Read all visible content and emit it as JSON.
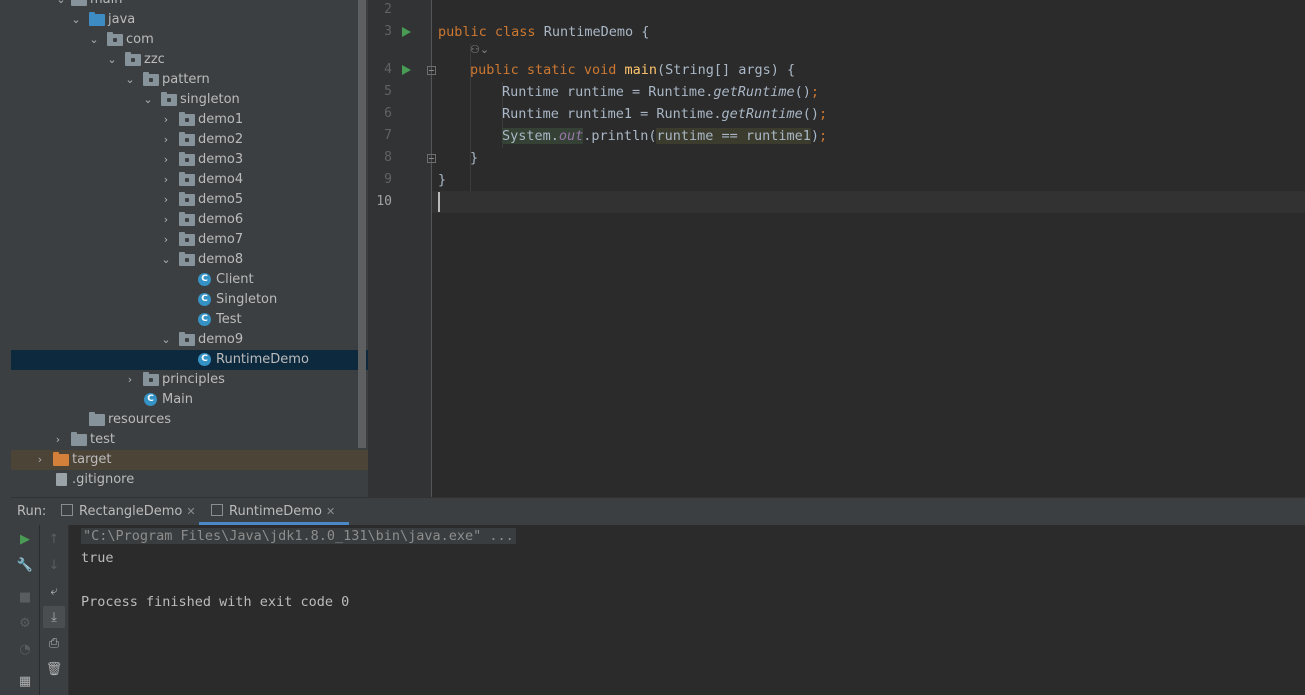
{
  "project_tree": {
    "items": [
      {
        "label": "main"
      },
      {
        "label": "java"
      },
      {
        "label": "com"
      },
      {
        "label": "zzc"
      },
      {
        "label": "pattern"
      },
      {
        "label": "singleton"
      },
      {
        "label": "demo1"
      },
      {
        "label": "demo2"
      },
      {
        "label": "demo3"
      },
      {
        "label": "demo4"
      },
      {
        "label": "demo5"
      },
      {
        "label": "demo6"
      },
      {
        "label": "demo7"
      },
      {
        "label": "demo8"
      },
      {
        "label": "Client"
      },
      {
        "label": "Singleton"
      },
      {
        "label": "Test"
      },
      {
        "label": "demo9"
      },
      {
        "label": "RuntimeDemo"
      },
      {
        "label": "principles"
      },
      {
        "label": "Main"
      },
      {
        "label": "resources"
      },
      {
        "label": "test"
      },
      {
        "label": "target"
      },
      {
        "label": ".gitignore"
      }
    ]
  },
  "editor": {
    "line_numbers": [
      "2",
      "3",
      "4",
      "5",
      "6",
      "7",
      "8",
      "9",
      "10"
    ],
    "current_line": "10",
    "lines": {
      "l3": {
        "kw1": "public",
        "kw2": "class",
        "name": "RuntimeDemo",
        "brace": "{"
      },
      "l4": {
        "kw1": "public",
        "kw2": "static",
        "kw3": "void",
        "fn": "main",
        "params": "(String[] args) {"
      },
      "l5": {
        "a": "Runtime runtime = Runtime.",
        "m": "getRuntime",
        "b": "()",
        "semi": ";"
      },
      "l6": {
        "a": "Runtime runtime1 = Runtime.",
        "m": "getRuntime",
        "b": "()",
        "semi": ";"
      },
      "l7": {
        "a": "System.",
        "f": "out",
        "b": ".println(",
        "c": "runtime == runtime1",
        "d": ")",
        "semi": ";"
      },
      "l8": {
        "t": "}"
      },
      "l9": {
        "t": "}"
      }
    }
  },
  "run_panel": {
    "label": "Run:",
    "tabs": [
      {
        "label": "RectangleDemo",
        "active": false
      },
      {
        "label": "RuntimeDemo",
        "active": true
      }
    ],
    "console": {
      "command": "\"C:\\Program Files\\Java\\jdk1.8.0_131\\bin\\java.exe\" ...",
      "output": "true",
      "finished": "Process finished with exit code 0"
    }
  },
  "colors": {
    "keyword": "#cc7832",
    "method_decl": "#ffc66d",
    "field": "#9876aa",
    "selection": "#0d293e",
    "run_green": "#499c54"
  }
}
